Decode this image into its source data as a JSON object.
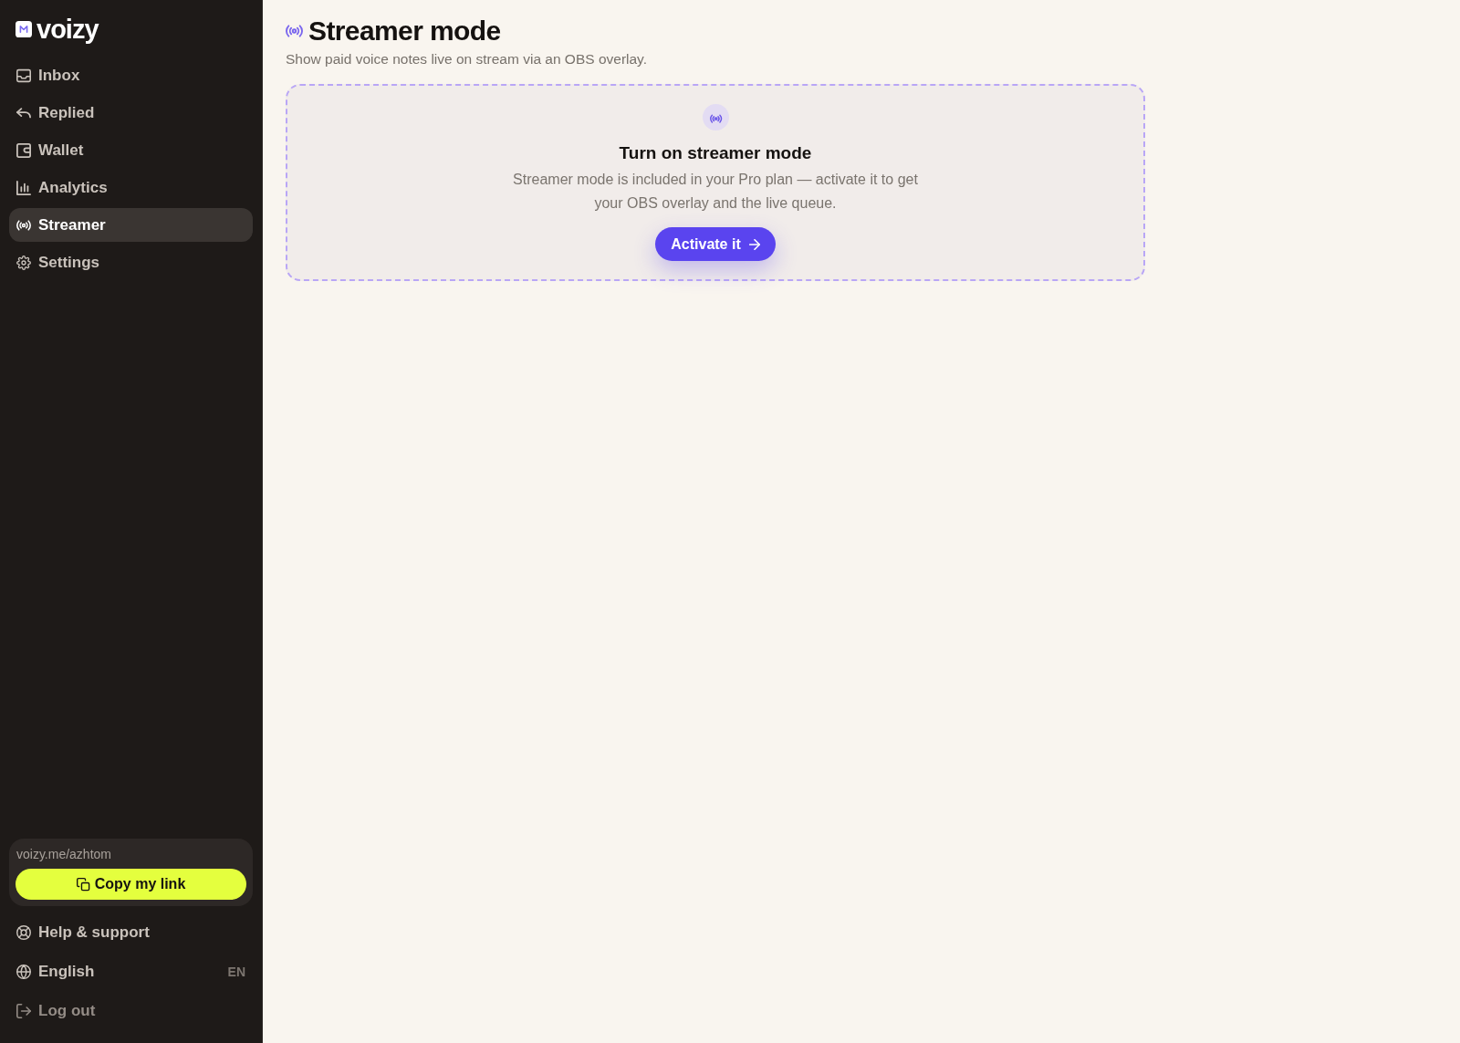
{
  "sidebar": {
    "logo": "voizy",
    "nav": [
      {
        "label": "Inbox",
        "selected": false
      },
      {
        "label": "Replied",
        "selected": false
      },
      {
        "label": "Wallet",
        "selected": false
      },
      {
        "label": "Analytics",
        "selected": false
      },
      {
        "label": "Streamer",
        "selected": true
      },
      {
        "label": "Settings",
        "selected": false
      }
    ],
    "link_card": {
      "url": "voizy.me/azhtom",
      "button": "Copy my link"
    },
    "footer": [
      {
        "label": "Help & support"
      },
      {
        "label": "English",
        "badge": "EN"
      },
      {
        "label": "Log out"
      }
    ]
  },
  "header": {
    "title": "Streamer mode",
    "subtitle": "Show paid voice notes live on stream via an OBS overlay."
  },
  "card": {
    "title": "Turn on streamer mode",
    "description": "Streamer mode is included in your Pro plan — activate it to get your OBS overlay and the live queue.",
    "button": "Activate it"
  }
}
